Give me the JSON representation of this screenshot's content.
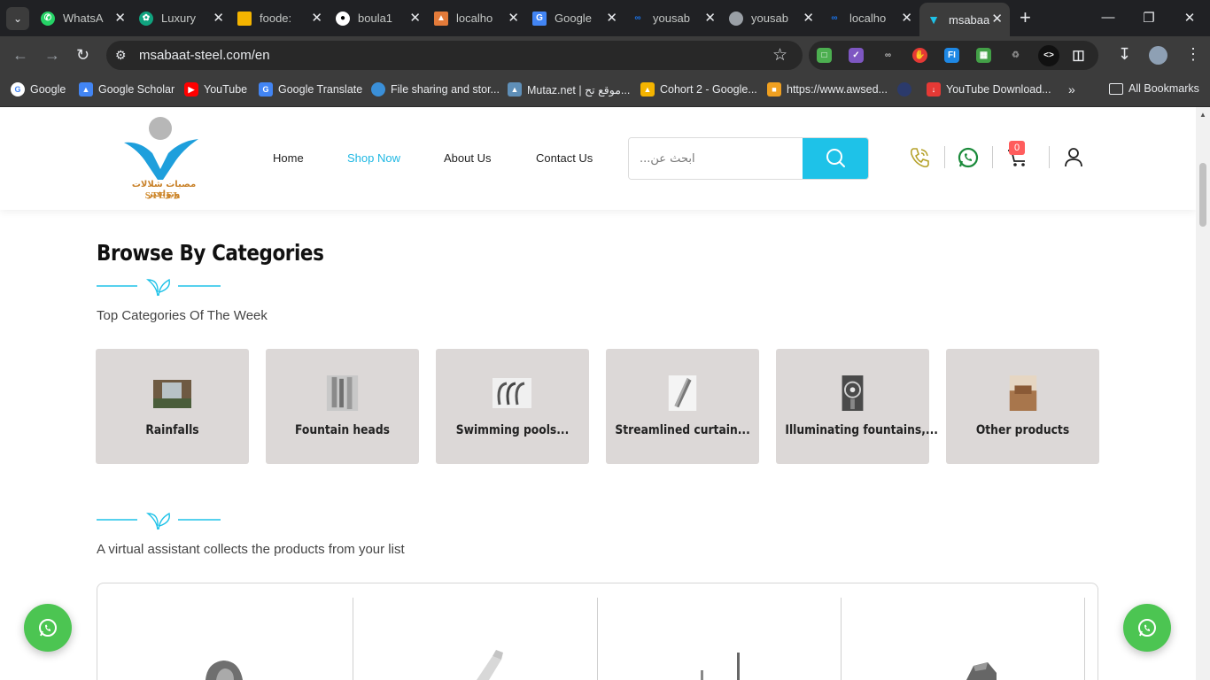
{
  "browser": {
    "tabs": [
      {
        "title": "WhatsA",
        "icon": "whatsapp-icon",
        "color": "#25d366"
      },
      {
        "title": "Luxury",
        "icon": "chatgpt-icon",
        "color": "#10a37f"
      },
      {
        "title": "foode:",
        "icon": "slides-icon",
        "color": "#f4b400"
      },
      {
        "title": "boula1",
        "icon": "github-icon",
        "color": "#ffffff"
      },
      {
        "title": "localho",
        "icon": "localhost-icon",
        "color": "#e37b3a"
      },
      {
        "title": "Google",
        "icon": "translate-icon",
        "color": "#4285f4"
      },
      {
        "title": "yousab",
        "icon": "link-icon",
        "color": "#1a73e8"
      },
      {
        "title": "yousab",
        "icon": "globe-icon",
        "color": "#9aa0a6"
      },
      {
        "title": "localho",
        "icon": "link-icon",
        "color": "#1a73e8"
      },
      {
        "title": "msabaa",
        "icon": "site-logo-icon",
        "color": "#1ec2e8",
        "active": true
      }
    ],
    "url": "msabaat-steel.com/en",
    "bookmarks": [
      {
        "label": "Google",
        "icon": "google-icon",
        "color": "#4285f4"
      },
      {
        "label": "Google Scholar",
        "icon": "scholar-icon",
        "color": "#4285f4"
      },
      {
        "label": "YouTube",
        "icon": "youtube-icon",
        "color": "#ff0000"
      },
      {
        "label": "Google Translate",
        "icon": "translate-icon",
        "color": "#4285f4"
      },
      {
        "label": "File sharing and stor...",
        "icon": "cloud-icon",
        "color": "#3a8fd8"
      },
      {
        "label": "Mutaz.net | موقع تح...",
        "icon": "mountain-icon",
        "color": "#5f8fb8"
      },
      {
        "label": "Cohort 2 - Google...",
        "icon": "drive-icon",
        "color": "#f4b400"
      },
      {
        "label": "https://www.awsed...",
        "icon": "box-icon",
        "color": "#f0a020"
      },
      {
        "label": "",
        "icon": "circle-icon",
        "color": "#2b3a6b"
      },
      {
        "label": "YouTube Download...",
        "icon": "download-icon",
        "color": "#e53935"
      }
    ],
    "all_bookmarks": "All Bookmarks"
  },
  "site": {
    "menu": [
      "Home",
      "Shop Now",
      "About Us",
      "Contact Us"
    ],
    "active_menu": "Shop Now",
    "search_placeholder": "ابحث عن...",
    "cart_count": "0",
    "logo_ar": "مصبات شلالات ونوافير",
    "logo_en": "STEEL",
    "accent": "#1ec2e8"
  },
  "categories": {
    "title": "Browse By Categories",
    "subtitle": "Top Categories Of The Week",
    "items": [
      {
        "label": "Rainfalls"
      },
      {
        "label": "Fountain heads"
      },
      {
        "label": "Swimming pools..."
      },
      {
        "label": "Streamlined curtain..."
      },
      {
        "label": "Illuminating fountains,..."
      },
      {
        "label": "Other products"
      }
    ]
  },
  "assistant": {
    "subtitle": "A virtual assistant collects the products from your list"
  }
}
